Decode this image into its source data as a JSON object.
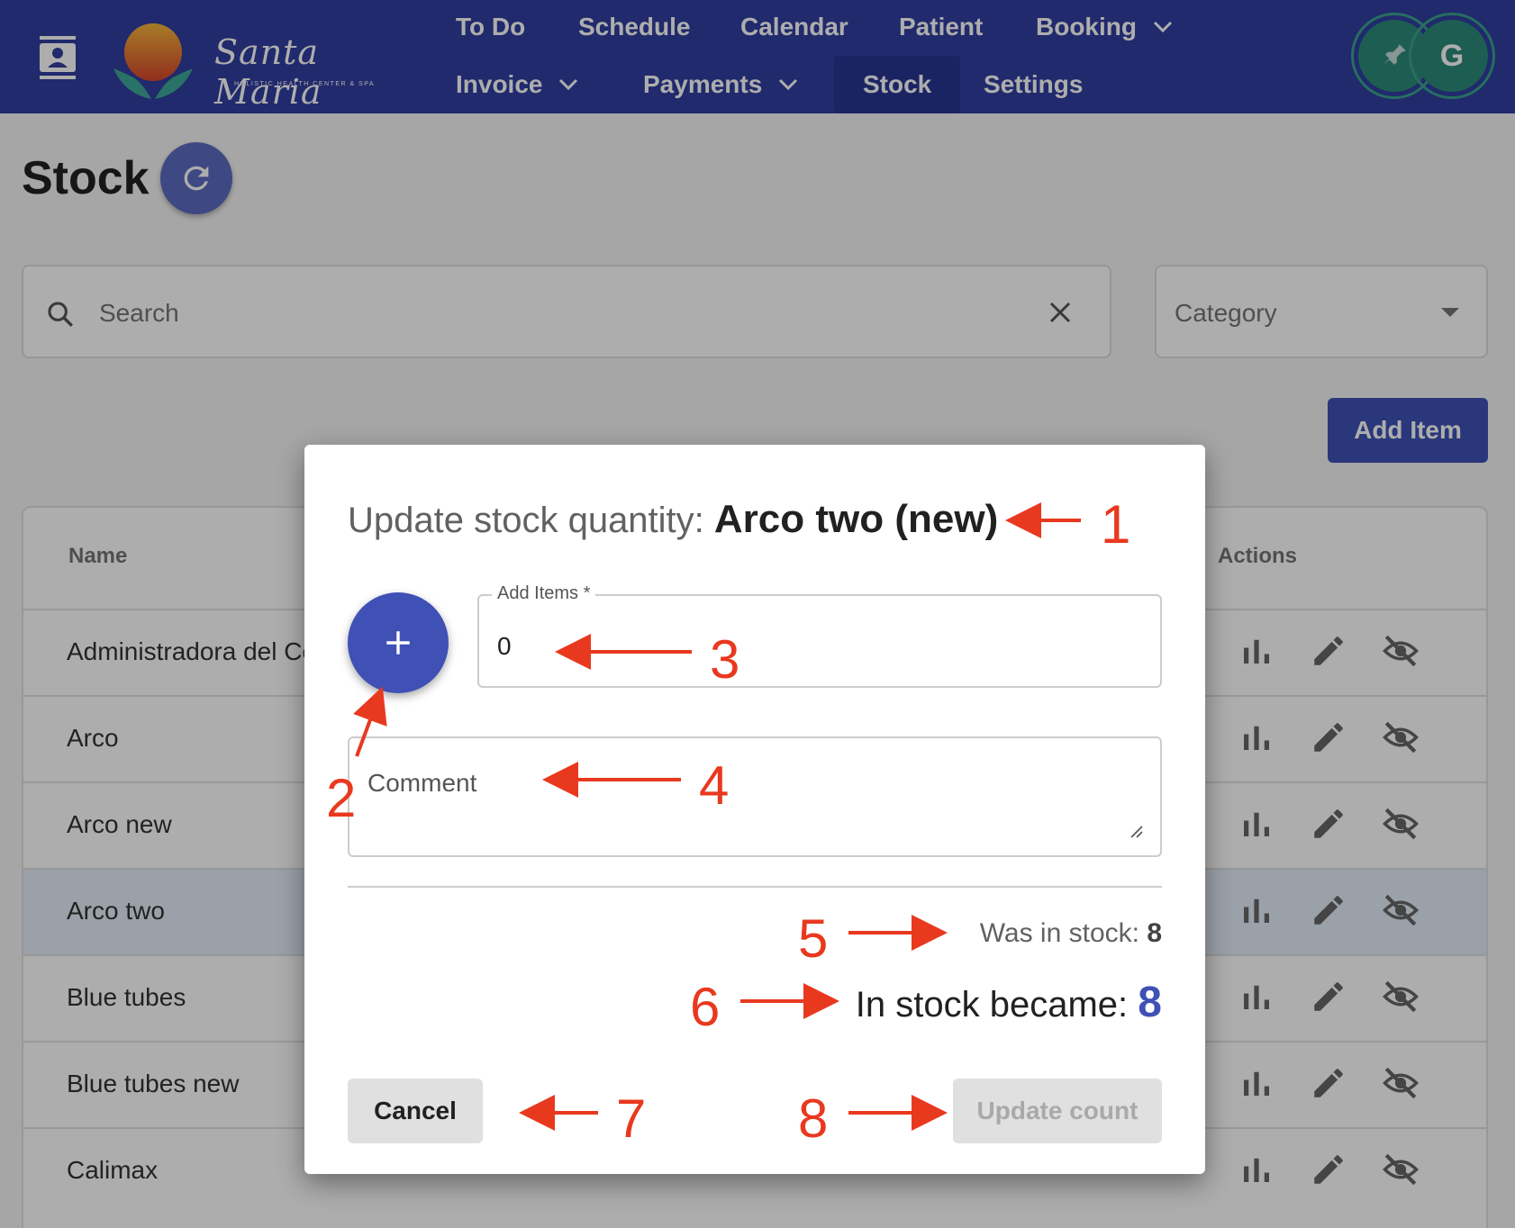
{
  "nav": {
    "logo_title": "Santa Maria",
    "logo_subtitle": "HOLISTIC HEALTH CENTER & SPA",
    "items": [
      {
        "label": "To Do"
      },
      {
        "label": "Schedule"
      },
      {
        "label": "Calendar"
      },
      {
        "label": "Patient"
      },
      {
        "label": "Booking"
      },
      {
        "label": "Invoice"
      },
      {
        "label": "Payments"
      },
      {
        "label": "Stock"
      },
      {
        "label": "Settings"
      }
    ],
    "avatar_letter": "G"
  },
  "page": {
    "title": "Stock",
    "search_placeholder": "Search",
    "category_placeholder": "Category",
    "add_item_label": "Add Item"
  },
  "table": {
    "headers": {
      "name": "Name",
      "actions": "Actions"
    },
    "rows": [
      {
        "name": "Administradora del Co"
      },
      {
        "name": "Arco"
      },
      {
        "name": "Arco new"
      },
      {
        "name": "Arco two"
      },
      {
        "name": "Blue tubes"
      },
      {
        "name": "Blue tubes new"
      },
      {
        "name": "Calimax"
      }
    ]
  },
  "dialog": {
    "title_prefix": "Update stock quantity:",
    "item_name": "Arco two (new)",
    "add_items_label": "Add Items *",
    "add_items_value": "0",
    "comment_label": "Comment",
    "was_in_stock_label": "Was in stock:",
    "was_in_stock_value": "8",
    "became_label": "In stock became:",
    "became_value": "8",
    "cancel_label": "Cancel",
    "update_label": "Update count"
  },
  "annotations": [
    "1",
    "2",
    "3",
    "4",
    "5",
    "6",
    "7",
    "8"
  ],
  "colors": {
    "primary": "#3f51b5",
    "nav_bg": "#303f9f",
    "annotation": "#e8391f"
  }
}
